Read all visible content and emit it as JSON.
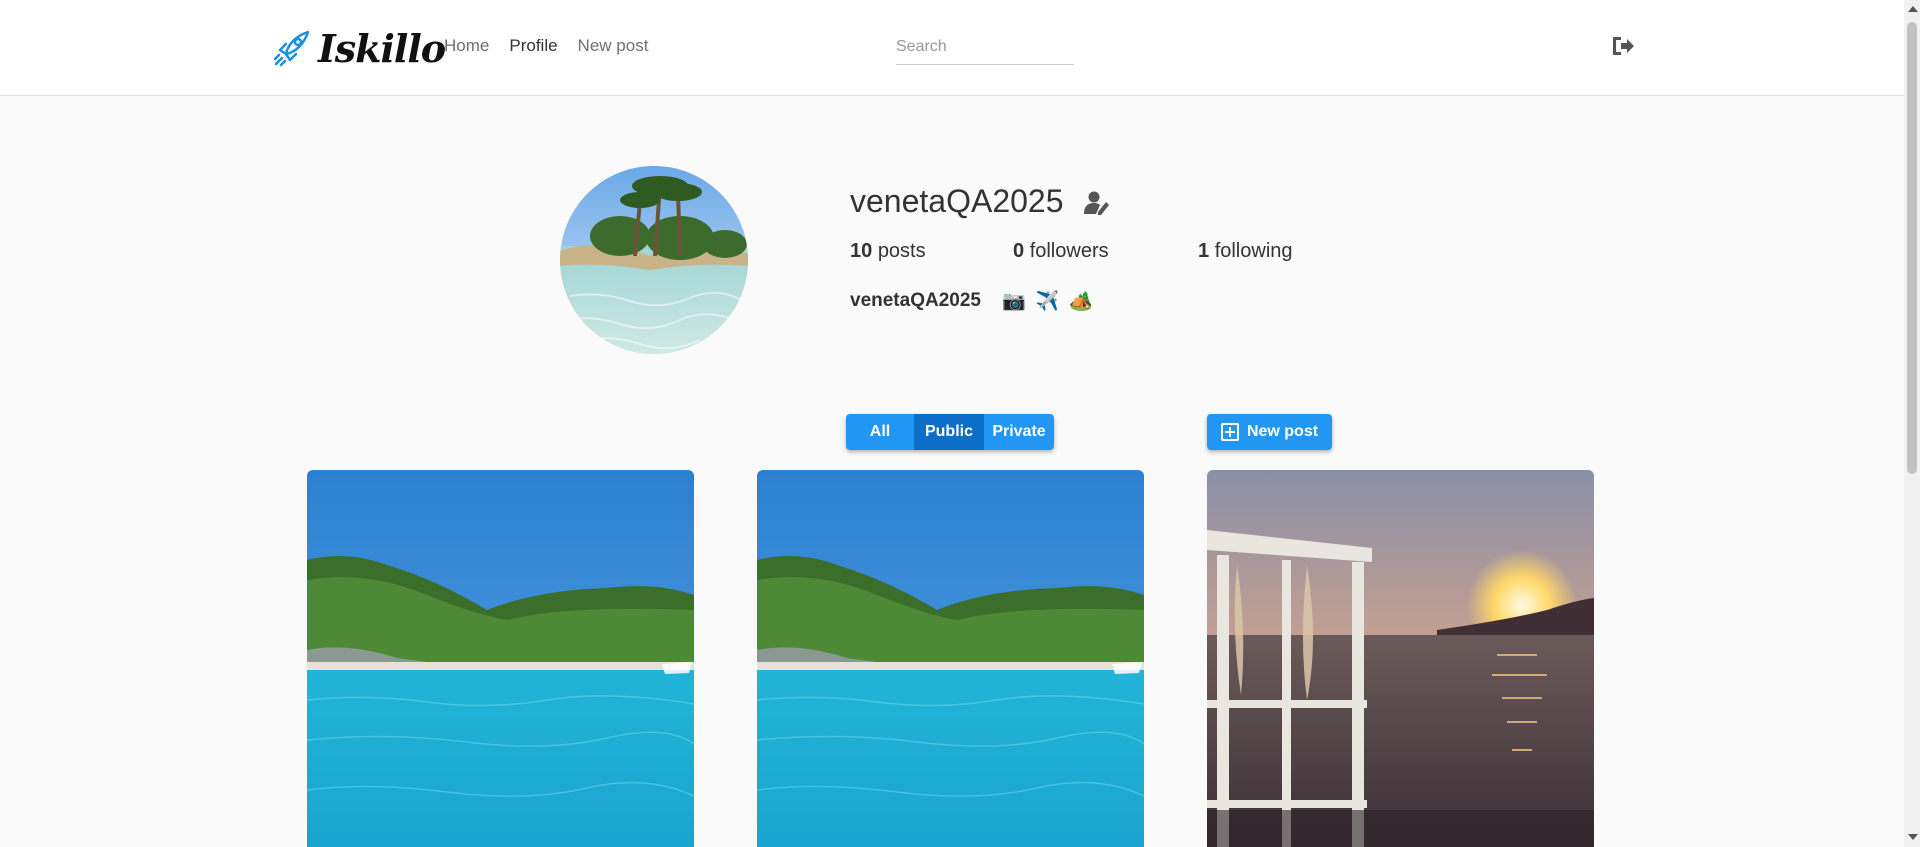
{
  "header": {
    "logo_text": "Iskillo",
    "nav": {
      "home": "Home",
      "profile": "Profile",
      "new_post": "New post"
    },
    "search_placeholder": "Search"
  },
  "profile": {
    "username": "venetaQA2025",
    "stats": {
      "posts_count": "10",
      "posts_label": "posts",
      "followers_count": "0",
      "followers_label": "followers",
      "following_count": "1",
      "following_label": "following"
    },
    "bio_name": "venetaQA2025",
    "bio_emojis": [
      "📷",
      "✈️",
      "🏕️"
    ]
  },
  "filters": {
    "all": "All",
    "public": "Public",
    "private": "Private",
    "selected": "Public"
  },
  "new_post_button": "New post",
  "colors": {
    "accent": "#2196f3",
    "accent_selected": "#0d6ec8",
    "page_bg": "#fafafa"
  },
  "icons": {
    "logo": "rocket-icon",
    "logout": "sign-out-icon",
    "edit_profile": "user-edit-icon",
    "new_post": "plus-square-icon"
  }
}
